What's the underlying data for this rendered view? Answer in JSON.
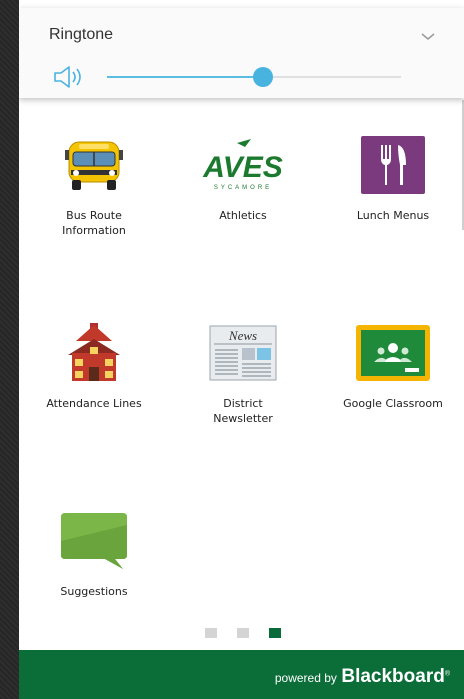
{
  "volume": {
    "title": "Ringtone",
    "level_percent": 53
  },
  "tiles": [
    {
      "label": "Bus Route Information",
      "icon": "school-bus-icon"
    },
    {
      "label": "Athletics",
      "icon": "aves-sycamore-logo",
      "logo_text": "AVES",
      "logo_subtext": "SYCAMORE"
    },
    {
      "label": "Lunch Menus",
      "icon": "fork-knife-icon"
    },
    {
      "label": "Attendance Lines",
      "icon": "schoolhouse-icon"
    },
    {
      "label": "District Newsletter",
      "icon": "newspaper-icon",
      "icon_text": "News"
    },
    {
      "label": "Google Classroom",
      "icon": "google-classroom-icon"
    },
    {
      "label": "Suggestions",
      "icon": "speech-bubble-icon"
    }
  ],
  "pager": {
    "pages": 3,
    "active": 3
  },
  "footer": {
    "powered_by": "powered by",
    "brand": "Blackboard"
  },
  "colors": {
    "footer_green": "#0b6d38",
    "slider_blue": "#49b3e0",
    "lunch_purple": "#7b3a7e",
    "classroom_green": "#1f8a3a",
    "classroom_border": "#f5b400",
    "suggestions_green": "#7ab648",
    "aves_green": "#1b7a2e"
  }
}
